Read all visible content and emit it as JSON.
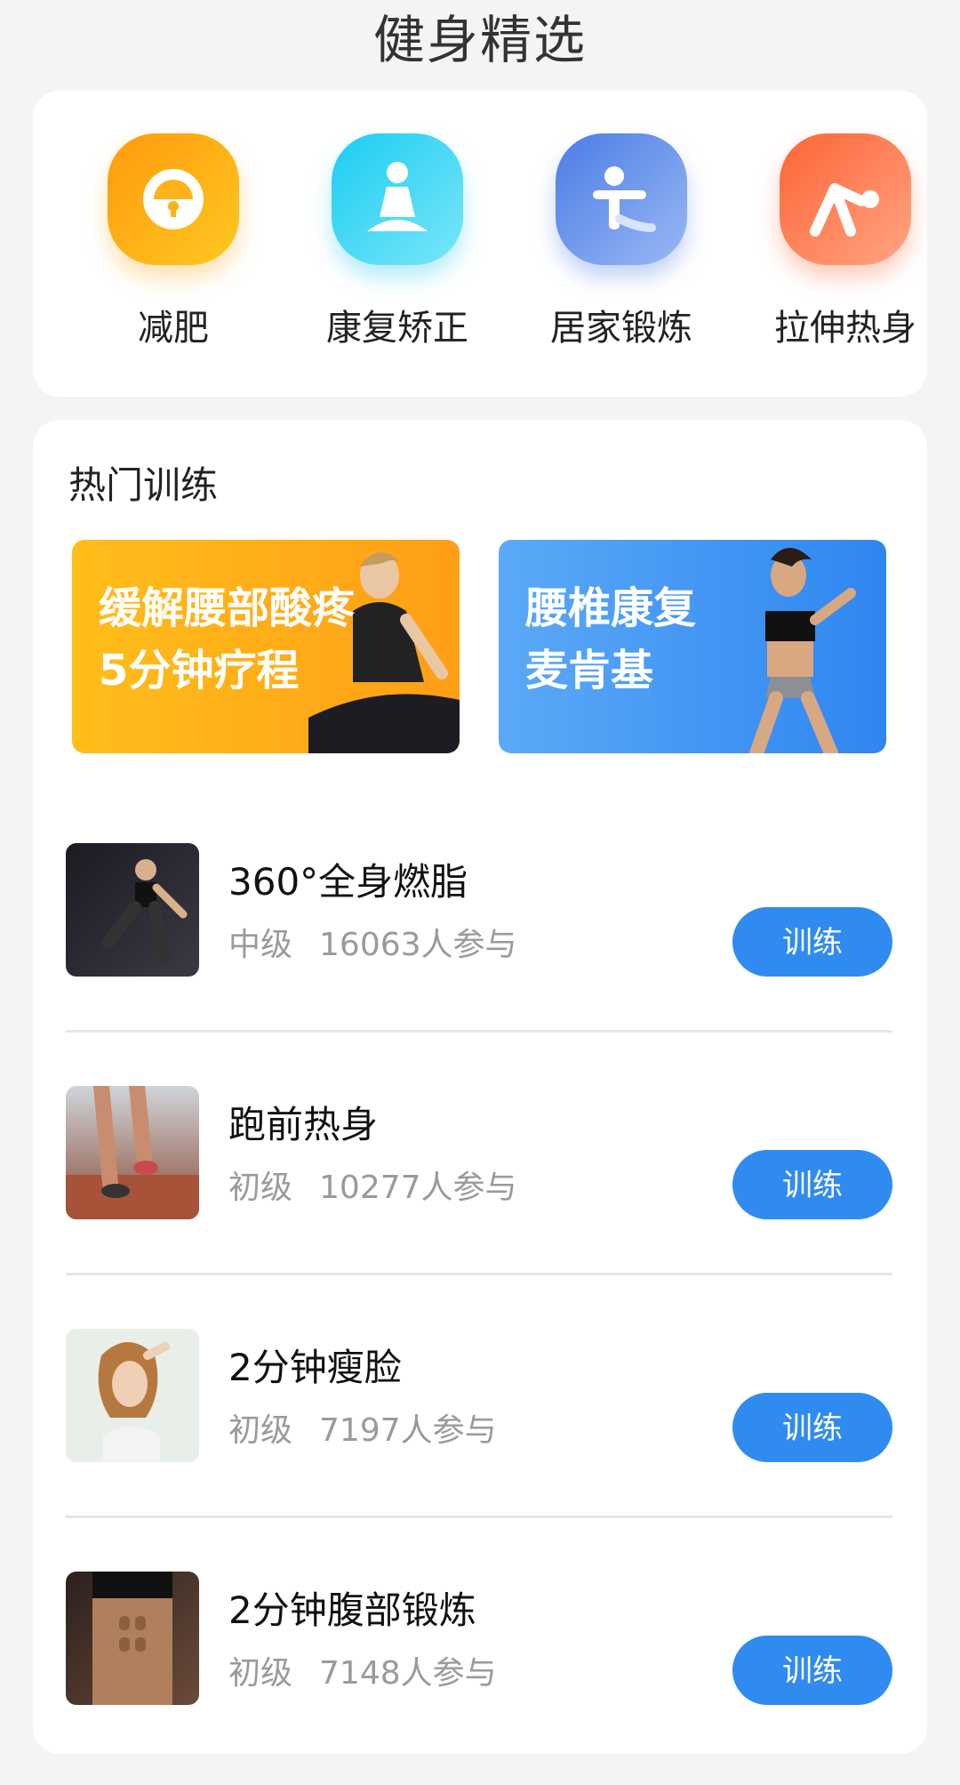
{
  "header": {
    "title": "健身精选"
  },
  "categories": [
    {
      "label": "减肥",
      "icon": "scale-icon",
      "color_from": "#ff9a0d",
      "color_to": "#ffc21a"
    },
    {
      "label": "康复矫正",
      "icon": "meditation-icon",
      "color_from": "#1fd0f3",
      "color_to": "#6fe3f7"
    },
    {
      "label": "居家锻炼",
      "icon": "home-exercise-icon",
      "color_from": "#4e7fe6",
      "color_to": "#8fb1f2"
    },
    {
      "label": "拉伸热身",
      "icon": "stretch-icon",
      "color_from": "#ff6b3d",
      "color_to": "#ffa07a"
    }
  ],
  "hot": {
    "title": "热门训练",
    "banners": [
      {
        "line1": "缓解腰部酸疼",
        "line2": "5分钟疗程",
        "color": "#ffa41a"
      },
      {
        "line1": "腰椎康复",
        "line2": "麦肯基",
        "color": "#3b95f5"
      }
    ],
    "items": [
      {
        "title": "360°全身燃脂",
        "level": "中级",
        "participants": "16063人参与",
        "button": "训练"
      },
      {
        "title": "跑前热身",
        "level": "初级",
        "participants": "10277人参与",
        "button": "训练"
      },
      {
        "title": "2分钟瘦脸",
        "level": "初级",
        "participants": "7197人参与",
        "button": "训练"
      },
      {
        "title": "2分钟腹部锻炼",
        "level": "初级",
        "participants": "7148人参与",
        "button": "训练"
      }
    ]
  },
  "colors": {
    "accent": "#2f8bf0",
    "background": "#f4f4f4"
  }
}
